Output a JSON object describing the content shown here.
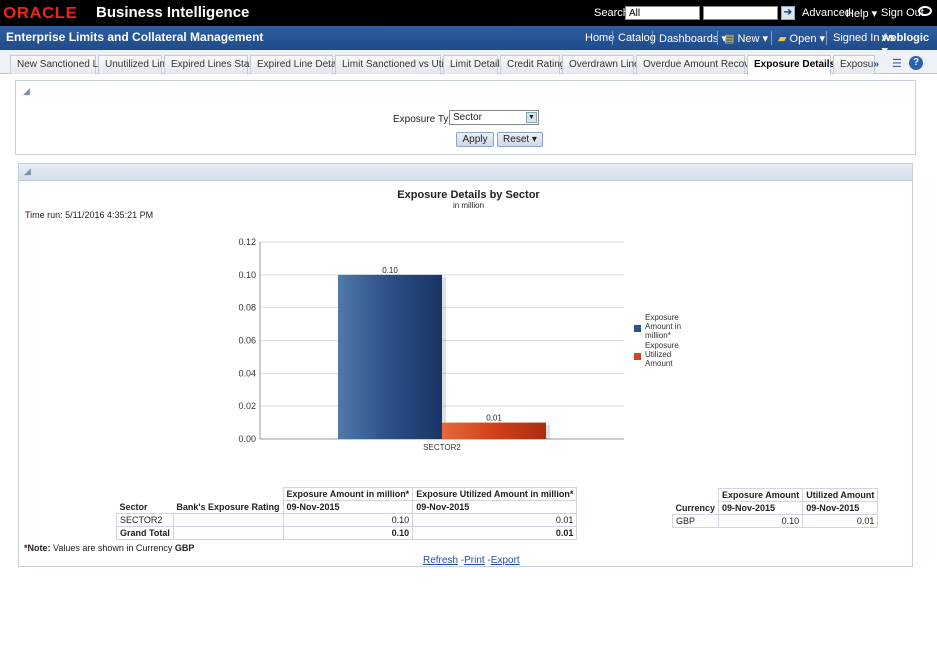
{
  "topbar": {
    "logo": "ORACLE",
    "product": "Business Intelligence",
    "search_label": "Search",
    "search_scope": "All",
    "links": [
      "Advanced",
      "Help ▾",
      "Sign Out"
    ]
  },
  "header": {
    "title": "Enterprise Limits and Collateral Management",
    "links": [
      "Home",
      "Catalog",
      "Dashboards ▾",
      "New ▾",
      "Open ▾"
    ],
    "signed_in_label": "Signed In As",
    "user": "weblogic ▾"
  },
  "tabs": [
    "New Sanctioned Limit",
    "Unutilized Limit",
    "Expired Lines Status",
    "Expired Line Details",
    "Limit Sanctioned vs Utilized",
    "Limit Details",
    "Credit Rating",
    "Overdrawn Lines",
    "Overdue Amount Recovery",
    "Exposure Details",
    "Exposu"
  ],
  "active_tab": "Exposure Details",
  "prompt": {
    "label": "Exposure Type",
    "value": "Sector",
    "apply": "Apply",
    "reset": "Reset ▾"
  },
  "report": {
    "title": "Exposure Details by Sector",
    "subtitle": "in million",
    "time_run": "Time run: 5/11/2016 4:35:21 PM"
  },
  "chart_data": {
    "type": "bar",
    "categories": [
      "SECTOR2"
    ],
    "series": [
      {
        "name": "Exposure Amount in million*",
        "values": [
          0.1
        ],
        "color": "#2d5289"
      },
      {
        "name": "Exposure Utilized Amount",
        "values": [
          0.01
        ],
        "color": "#d8451c"
      }
    ],
    "data_labels": [
      "0.10",
      "0.01"
    ],
    "yticks": [
      "0.00",
      "0.02",
      "0.04",
      "0.06",
      "0.08",
      "0.10",
      "0.12"
    ],
    "ylim": [
      0,
      0.12
    ],
    "legend_lines": [
      [
        "Exposure",
        "Amount in",
        "million*"
      ],
      [
        "Exposure",
        "Utilized",
        "Amount"
      ]
    ],
    "legend_position": "right",
    "grid": true
  },
  "table1": {
    "col_heads": [
      "Exposure Amount in million*",
      "Exposure Utilized Amount in million*"
    ],
    "row_heads": [
      "Sector",
      "Bank's Exposure Rating"
    ],
    "dates": [
      "09-Nov-2015",
      "09-Nov-2015"
    ],
    "rows": [
      {
        "sector": "SECTOR2",
        "rating": "",
        "amount": "0.10",
        "utilized": "0.01"
      }
    ],
    "total": {
      "label": "Grand Total",
      "amount": "0.10",
      "utilized": "0.01"
    }
  },
  "table2": {
    "col_heads": [
      "Exposure Amount",
      "Utilized Amount"
    ],
    "row_head": "Currency",
    "dates": [
      "09-Nov-2015",
      "09-Nov-2015"
    ],
    "rows": [
      {
        "currency": "GBP",
        "amount": "0.10",
        "utilized": "0.01"
      }
    ]
  },
  "note": {
    "prefix": "*Note:",
    "text": " Values are shown in Currency ",
    "currency": "GBP"
  },
  "footer_links": [
    "Refresh",
    "Print",
    "Export"
  ]
}
